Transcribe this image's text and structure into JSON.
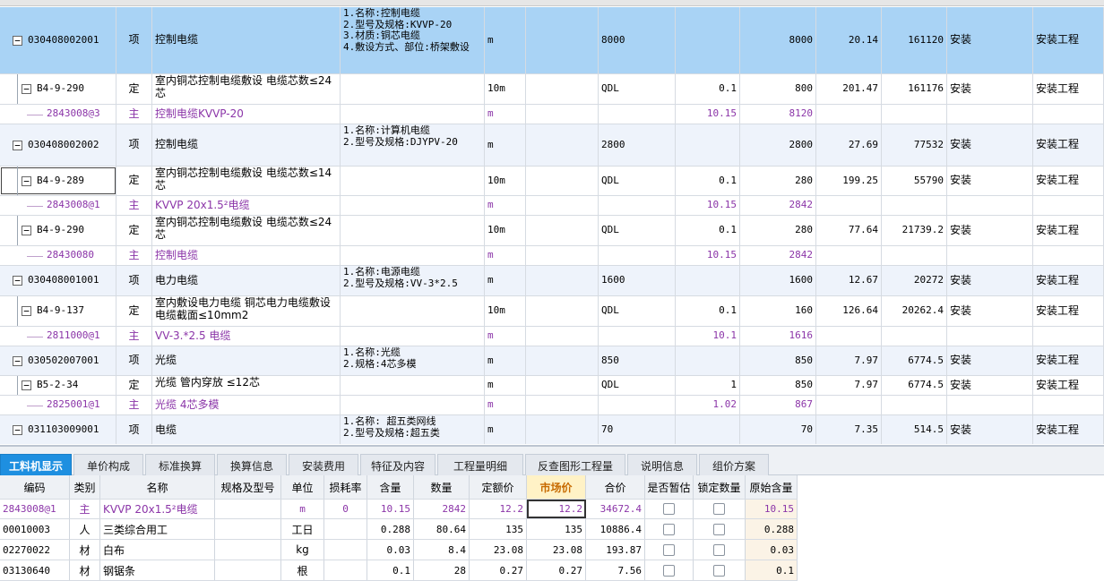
{
  "top_grid": {
    "rows": [
      {
        "type": "item",
        "selected": true,
        "code": "030408002001",
        "category": "项",
        "name": "控制电缆",
        "features": [
          "1.名称:控制电缆",
          "2.型号及规格:KVVP-20",
          "3.材质:铜芯电缆",
          "4.敷设方式、部位:桥架敷设"
        ],
        "unit": "m",
        "expr": "8000",
        "content": "",
        "quantity": "8000",
        "unit_price": "20.14",
        "total": "161120",
        "discipline": "安装",
        "fee_type": "安装工程"
      },
      {
        "type": "sub",
        "code": "B4-9-290",
        "category": "定",
        "name": "室内铜芯控制电缆敷设 电缆芯数≤24芯",
        "features": [],
        "unit": "10m",
        "expr": "QDL",
        "content": "0.1",
        "quantity": "800",
        "unit_price": "201.47",
        "total": "161176",
        "discipline": "安装",
        "fee_type": "安装工程"
      },
      {
        "type": "mat",
        "code": "2843008@3",
        "category": "主",
        "name": "控制电缆KVVP-20",
        "features": [],
        "unit": "m",
        "expr": "",
        "content": "10.15",
        "quantity": "8120",
        "unit_price": "",
        "total": "",
        "discipline": "",
        "fee_type": ""
      },
      {
        "type": "item",
        "code": "030408002002",
        "category": "项",
        "name": "控制电缆",
        "features": [
          "1.名称:计算机电缆",
          "2.型号及规格:DJYPV-20"
        ],
        "unit": "m",
        "expr": "2800",
        "content": "",
        "quantity": "2800",
        "unit_price": "27.69",
        "total": "77532",
        "discipline": "安装",
        "fee_type": "安装工程"
      },
      {
        "type": "sub",
        "focus": true,
        "code": "B4-9-289",
        "category": "定",
        "name": "室内铜芯控制电缆敷设 电缆芯数≤14芯",
        "features": [],
        "unit": "10m",
        "expr": "QDL",
        "content": "0.1",
        "quantity": "280",
        "unit_price": "199.25",
        "total": "55790",
        "discipline": "安装",
        "fee_type": "安装工程"
      },
      {
        "type": "mat",
        "code": "2843008@1",
        "category": "主",
        "name": "KVVP 20x1.5²电缆",
        "features": [],
        "unit": "m",
        "expr": "",
        "content": "10.15",
        "quantity": "2842",
        "unit_price": "",
        "total": "",
        "discipline": "",
        "fee_type": ""
      },
      {
        "type": "sub",
        "code": "B4-9-290",
        "category": "定",
        "name": "室内铜芯控制电缆敷设 电缆芯数≤24芯",
        "features": [],
        "unit": "10m",
        "expr": "QDL",
        "content": "0.1",
        "quantity": "280",
        "unit_price": "77.64",
        "total": "21739.2",
        "discipline": "安装",
        "fee_type": "安装工程"
      },
      {
        "type": "mat",
        "code": "28430080",
        "category": "主",
        "name": "控制电缆",
        "features": [],
        "unit": "m",
        "expr": "",
        "content": "10.15",
        "quantity": "2842",
        "unit_price": "",
        "total": "",
        "discipline": "",
        "fee_type": ""
      },
      {
        "type": "item",
        "code": "030408001001",
        "category": "项",
        "name": "电力电缆",
        "features": [
          "1.名称:电源电缆",
          "2.型号及规格:VV-3*2.5"
        ],
        "unit": "m",
        "expr": "1600",
        "content": "",
        "quantity": "1600",
        "unit_price": "12.67",
        "total": "20272",
        "discipline": "安装",
        "fee_type": "安装工程"
      },
      {
        "type": "sub",
        "code": "B4-9-137",
        "category": "定",
        "name": "室内敷设电力电缆 铜芯电力电缆敷设 电缆截面≤10mm2",
        "features": [],
        "unit": "10m",
        "expr": "QDL",
        "content": "0.1",
        "quantity": "160",
        "unit_price": "126.64",
        "total": "20262.4",
        "discipline": "安装",
        "fee_type": "安装工程"
      },
      {
        "type": "mat",
        "code": "2811000@1",
        "category": "主",
        "name": "VV-3.*2.5 电缆",
        "features": [],
        "unit": "m",
        "expr": "",
        "content": "10.1",
        "quantity": "1616",
        "unit_price": "",
        "total": "",
        "discipline": "",
        "fee_type": ""
      },
      {
        "type": "item",
        "code": "030502007001",
        "category": "项",
        "name": "光缆",
        "features": [
          "1.名称:光缆",
          "2.规格:4芯多模"
        ],
        "unit": "m",
        "expr": "850",
        "content": "",
        "quantity": "850",
        "unit_price": "7.97",
        "total": "6774.5",
        "discipline": "安装",
        "fee_type": "安装工程"
      },
      {
        "type": "sub",
        "code": "B5-2-34",
        "category": "定",
        "name": "光缆 管内穿放 ≤12芯",
        "features": [],
        "unit": "m",
        "expr": "QDL",
        "content": "1",
        "quantity": "850",
        "unit_price": "7.97",
        "total": "6774.5",
        "discipline": "安装",
        "fee_type": "安装工程"
      },
      {
        "type": "mat",
        "code": "2825001@1",
        "category": "主",
        "name": "光缆 4芯多模",
        "features": [],
        "unit": "m",
        "expr": "",
        "content": "1.02",
        "quantity": "867",
        "unit_price": "",
        "total": "",
        "discipline": "",
        "fee_type": ""
      },
      {
        "type": "item",
        "code": "031103009001",
        "category": "项",
        "name": "电缆",
        "features": [
          "1.名称: 超五类网线",
          "2.型号及规格:超五类"
        ],
        "unit": "m",
        "expr": "70",
        "content": "",
        "quantity": "70",
        "unit_price": "7.35",
        "total": "514.5",
        "discipline": "安装",
        "fee_type": "安装工程"
      }
    ]
  },
  "tabs": [
    "工料机显示",
    "单价构成",
    "标准换算",
    "换算信息",
    "安装费用",
    "特征及内容",
    "工程量明细",
    "反查图形工程量",
    "说明信息",
    "组价方案"
  ],
  "active_tab": 0,
  "bottom_grid": {
    "headers": [
      "编码",
      "类别",
      "名称",
      "规格及型号",
      "单位",
      "损耗率",
      "含量",
      "数量",
      "定额价",
      "市场价",
      "合价",
      "是否暂估",
      "锁定数量",
      "原始含量"
    ],
    "rows": [
      {
        "code": "2843008@1",
        "category": "主",
        "name": "KVVP 20x1.5²电缆",
        "spec": "",
        "unit": "m",
        "loss": "0",
        "content": "10.15",
        "quantity": "2842",
        "quota_price": "12.2",
        "market_price": "12.2",
        "total": "34672.4",
        "orig": "10.15",
        "highlight": true
      },
      {
        "code": "00010003",
        "category": "人",
        "name": "三类综合用工",
        "spec": "",
        "unit": "工日",
        "loss": "",
        "content": "0.288",
        "quantity": "80.64",
        "quota_price": "135",
        "market_price": "135",
        "total": "10886.4",
        "orig": "0.288"
      },
      {
        "code": "02270022",
        "category": "材",
        "name": "白布",
        "spec": "",
        "unit": "kg",
        "loss": "",
        "content": "0.03",
        "quantity": "8.4",
        "quota_price": "23.08",
        "market_price": "23.08",
        "total": "193.87",
        "orig": "0.03"
      },
      {
        "code": "03130640",
        "category": "材",
        "name": "钢锯条",
        "spec": "",
        "unit": "根",
        "loss": "",
        "content": "0.1",
        "quantity": "28",
        "quota_price": "0.27",
        "market_price": "0.27",
        "total": "7.56",
        "orig": "0.1"
      }
    ]
  },
  "colors": {
    "selected_row": "#a9d3f5",
    "item_row": "#eef3fb",
    "material_text": "#8b35a8",
    "active_tab": "#1e8fe0",
    "market_header": "#fff2c6"
  }
}
